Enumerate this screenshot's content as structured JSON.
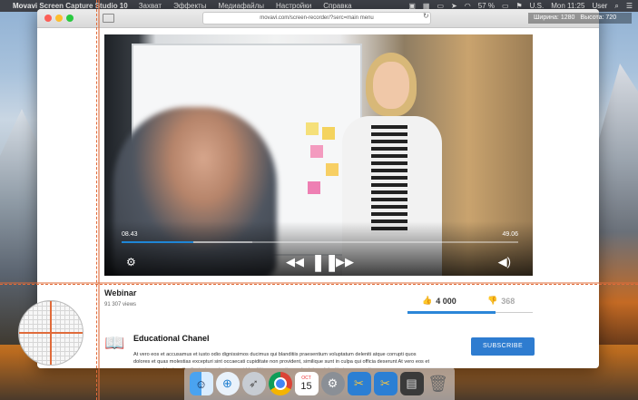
{
  "menubar": {
    "app_name": "Movavi Screen Capture Studio 10",
    "items": [
      "Захват",
      "Эффекты",
      "Медиафайлы",
      "Настройки",
      "Справка"
    ],
    "battery": "57 %",
    "input_source": "U.S.",
    "clock": "Mon 11:25",
    "user": "User"
  },
  "capture_overlay": {
    "width_label": "Ширина:",
    "width_value": "1280",
    "height_label": "Высота:",
    "height_value": "720"
  },
  "browser": {
    "url": "movavi.com/screen-recorder/?serc=main menu"
  },
  "video": {
    "current_time": "08.43",
    "duration": "49.06",
    "progress_fraction": 0.18,
    "buffered_fraction": 0.33
  },
  "info": {
    "title": "Webinar",
    "views": "91 307 views",
    "likes": "4 000",
    "dislikes": "368",
    "like_ratio": 0.7
  },
  "channel": {
    "name": "Educational Chanel",
    "description": "At vero eos et accusamus et iusto odio dignissimos ducimus qui blanditiis praesentium voluptatum deleniti atque corrupti quos dolores et quas molestias excepturi sint occaecati cupiditate non provident, similique sunt in culpa qui officia deserunt At vero eos et accusamus et iusto odio dignissimos ducimus qui blanditiis praesentium voluptatum deleniti atque corrupti",
    "subscribe_label": "SUBSCRIBE"
  },
  "dock": {
    "calendar_month": "OCT",
    "calendar_day": "15"
  }
}
